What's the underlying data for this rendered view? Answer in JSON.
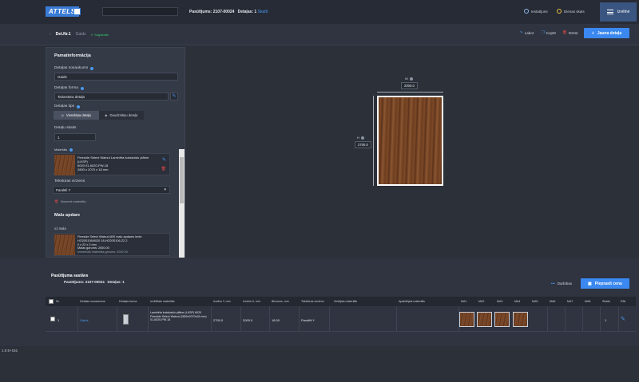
{
  "app": {
    "logo": "ATTELS"
  },
  "header": {
    "order_label": "Pasūtījums: 2107-00024",
    "parts_label": "Detaļas: 1",
    "parts_link": "Skatīt",
    "settings_label": "Iestatījumi",
    "tab_label": "Dienas skats",
    "menu_label": "Izvēlne"
  },
  "subbar": {
    "crumb_current": "Det.Nr.1",
    "crumb_next": "Gaids",
    "status": "Saglabāts",
    "edit_label": "Labot",
    "copy_label": "Kopēt",
    "delete_label": "Dzēst",
    "new_button": "Jauna detaļa"
  },
  "basic": {
    "title": "Pamatinformācija",
    "name_label": "Detaļas nosaukums",
    "name_value": "Gaids",
    "form_label": "Detaļas forma",
    "form_value": "Taisnstūra detaļa",
    "type_label": "Detaļas tips",
    "type_single": "Vienslāņa detaļa",
    "type_double": "Daudzslāņu detaļa",
    "count_label": "Detaļu skaits",
    "count_value": "1",
    "material_label": "Materiāls",
    "material_name": "Fineside Select Walnut Laminēta kokskaidu plātne (LKSP)",
    "material_code": "6020 01-6020-PW-18",
    "material_size": "2800 x 2070 x 18 mm",
    "texture_label": "Tekstūras virziens",
    "texture_value": "Paralēli Y",
    "remove_material": "Noņemt materiālu"
  },
  "edges": {
    "title": "Malu apdare",
    "side_label": "x1 mala",
    "edge_name": "Fineside Select Walnut ABS malu apdares lente",
    "edge_code": "HO20S106/6020 18-HO20S106-22-2",
    "edge_size": "0 x 22 x 2 mm",
    "edge_length": "Malas garums: 2000.00",
    "edge_used": "Izmantotā materiāla garums: 2000.00"
  },
  "canvas": {
    "width_key": "W",
    "height_key": "H",
    "width_value": "2000.0",
    "height_value": "2700.0"
  },
  "composition": {
    "title": "Pasūtījuma sastāvs",
    "order_label": "Pasūtījums: 2107-00024",
    "parts_label": "Detaļas: 1",
    "actions_label": "Darbības",
    "calc_button": "Pieprasīt cenu"
  },
  "table": {
    "headers": [
      "Nr.",
      "Detaļas nosaukums",
      "Detaļas forma",
      "Izvēlētais materiāls",
      "Izmērs Y, mm",
      "Izmērs X, mm",
      "Biezums, mm",
      "Tekstūras virziens",
      "Virsējais materiāls",
      "Apakšējais materiāls",
      "MA1",
      "MA2",
      "MA3",
      "MA4",
      "MA5",
      "MA6",
      "MA7",
      "MA8",
      "Skaits",
      "Rīki"
    ],
    "row": {
      "nr": "1",
      "name": "Gaids",
      "material": "Laminēta kokskaidu plātne (LKSP) 6020 Fineside Select Walnut (2800x2070x18 mm) 01-6020-PW-18",
      "size_y": "2700.0",
      "size_x": "2000.0",
      "thickness": "18.00",
      "texture": "Paralēli Y",
      "count": "1"
    }
  },
  "footer": {
    "coords": "1.0.5+151"
  },
  "colors": {
    "accent": "#3a88f0",
    "background": "#2f3440",
    "danger": "#e04848",
    "success": "#3cc36b"
  }
}
